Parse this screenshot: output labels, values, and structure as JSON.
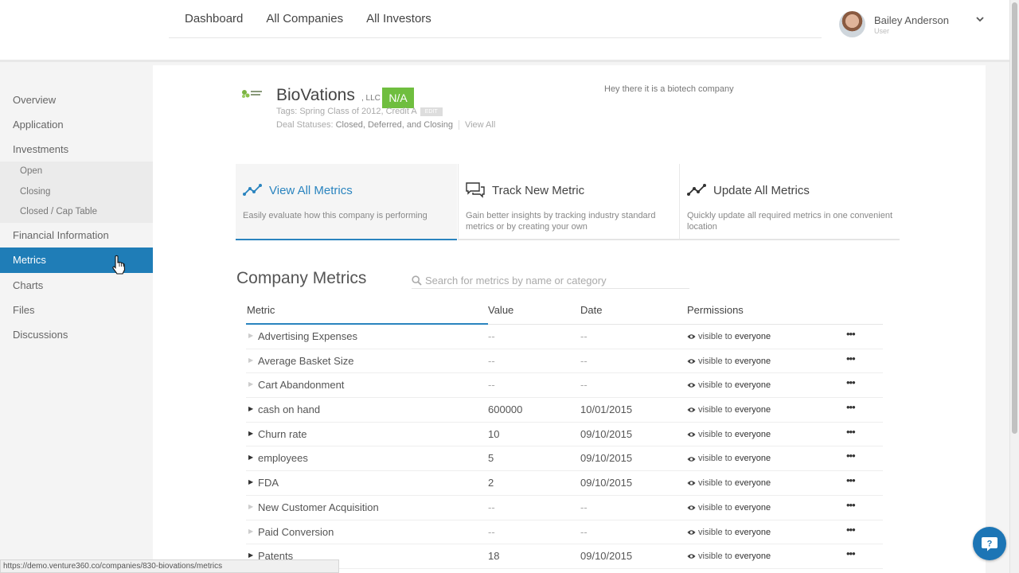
{
  "colors": {
    "accent": "#2a84bf",
    "active_sidebar": "#1f7db7",
    "badge_green": "#6fbe3f"
  },
  "topnav": {
    "items": [
      "Dashboard",
      "All Companies",
      "All Investors"
    ]
  },
  "user": {
    "name": "Bailey Anderson",
    "role": "User"
  },
  "sidebar": {
    "overview": "Overview",
    "application": "Application",
    "investments": "Investments",
    "sub": [
      "Open",
      "Closing",
      "Closed / Cap Table"
    ],
    "financial": "Financial Information",
    "metrics": "Metrics",
    "charts": "Charts",
    "files": "Files",
    "discussions": "Discussions"
  },
  "company": {
    "name": "BioVations",
    "suffix": ", LLC",
    "badge": "N/A",
    "tags_label": "Tags: Spring Class of 2012, Credit A",
    "edit_label": "EDIT",
    "deal_label": "Deal Statuses:",
    "deal_values": "Closed, Deferred, and Closing",
    "view_all": "View All",
    "description": "Hey there it is a biotech company"
  },
  "cards": [
    {
      "title": "View All Metrics",
      "desc": "Easily evaluate how this company is performing",
      "icon": "trend-line-icon"
    },
    {
      "title": "Track New Metric",
      "desc": "Gain better insights by tracking industry standard metrics or by creating your own",
      "icon": "chat-bubbles-icon"
    },
    {
      "title": "Update All Metrics",
      "desc": "Quickly update all required metrics in one convenient location",
      "icon": "trend-line-icon"
    }
  ],
  "metrics": {
    "title": "Company Metrics",
    "search_placeholder": "Search for metrics by name or category",
    "columns": {
      "metric": "Metric",
      "value": "Value",
      "date": "Date",
      "permissions": "Permissions"
    },
    "perm_prefix": "visible to",
    "perm_target": "everyone",
    "more_label": "•••",
    "rows": [
      {
        "name": "Advertising Expenses",
        "value": "--",
        "date": "--"
      },
      {
        "name": "Average Basket Size",
        "value": "--",
        "date": "--"
      },
      {
        "name": "Cart Abandonment",
        "value": "--",
        "date": "--"
      },
      {
        "name": "cash on hand",
        "value": "600000",
        "date": "10/01/2015"
      },
      {
        "name": "Churn rate",
        "value": "10",
        "date": "09/10/2015"
      },
      {
        "name": "employees",
        "value": "5",
        "date": "09/10/2015"
      },
      {
        "name": "FDA",
        "value": "2",
        "date": "09/10/2015"
      },
      {
        "name": "New Customer Acquisition",
        "value": "--",
        "date": "--"
      },
      {
        "name": "Paid Conversion",
        "value": "--",
        "date": "--"
      },
      {
        "name": "Patents",
        "value": "18",
        "date": "09/10/2015"
      }
    ]
  },
  "statusbar": {
    "url": "https://demo.venture360.co/companies/830-biovations/metrics"
  }
}
